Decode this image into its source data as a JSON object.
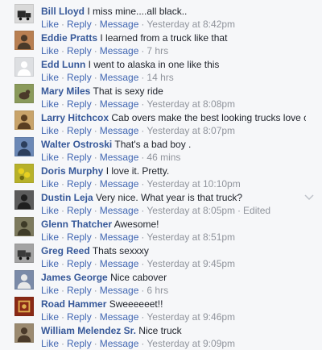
{
  "actions": {
    "like": "Like",
    "reply": "Reply",
    "message": "Message",
    "separator": "·"
  },
  "comments": [
    {
      "author": "Bill Lloyd",
      "text": "I miss mine....all black..",
      "time": "Yesterday at 8:42pm",
      "edited": "",
      "avatar": {
        "bg": "#d9d9d9",
        "fg": "#2a2a2a",
        "icon": "truck-photo-icon"
      }
    },
    {
      "author": "Eddie Pratts",
      "text": "I learned from a truck like that",
      "time": "7 hrs",
      "edited": "",
      "avatar": {
        "bg": "#b87f52",
        "fg": "#4a3a2a",
        "icon": "person-photo-icon"
      }
    },
    {
      "author": "Edd Lunn",
      "text": "I went to alaska in one like this",
      "time": "14 hrs",
      "edited": "",
      "avatar": {
        "bg": "#dddfe2",
        "fg": "#ffffff",
        "icon": "default-profile-icon"
      }
    },
    {
      "author": "Mary Miles",
      "text": "That is sexy ride",
      "time": "Yesterday at 8:08pm",
      "edited": "",
      "avatar": {
        "bg": "#8a9a5b",
        "fg": "#4b3a2a",
        "icon": "animal-photo-icon"
      }
    },
    {
      "author": "Larry Hitchcox",
      "text": "Cab overs make the best looking trucks love cab overs",
      "time": "Yesterday at 8:07pm",
      "edited": "",
      "avatar": {
        "bg": "#c8a36a",
        "fg": "#5a3f22",
        "icon": "person-photo-icon"
      }
    },
    {
      "author": "Walter Ostroski",
      "text": "That's a bad boy .",
      "time": "46 mins",
      "edited": "",
      "avatar": {
        "bg": "#6b88b6",
        "fg": "#2c3e5c",
        "icon": "person-photo-icon"
      }
    },
    {
      "author": "Doris Murphy",
      "text": "I love it. Pretty.",
      "time": "Yesterday at 10:10pm",
      "edited": "",
      "avatar": {
        "bg": "#b7b12a",
        "fg": "#6f6a10",
        "icon": "flower-photo-icon"
      }
    },
    {
      "author": "Dustin Leja",
      "text": "Very nice. What year is that truck?",
      "time": "Yesterday at 8:05pm",
      "edited": "Edited",
      "avatar": {
        "bg": "#5b5b5b",
        "fg": "#1f1f1f",
        "icon": "person-photo-icon"
      }
    },
    {
      "author": "Glenn Thatcher",
      "text": "Awesome!",
      "time": "Yesterday at 8:51pm",
      "edited": "",
      "avatar": {
        "bg": "#7d7a5e",
        "fg": "#3e3b28",
        "icon": "person-photo-icon"
      }
    },
    {
      "author": "Greg Reed",
      "text": "Thats sexxxy",
      "time": "Yesterday at 9:45pm",
      "edited": "",
      "avatar": {
        "bg": "#a3a3a3",
        "fg": "#3a3a3a",
        "icon": "truck-photo-icon"
      }
    },
    {
      "author": "James George",
      "text": "Nice cabover",
      "time": "6 hrs",
      "edited": "",
      "avatar": {
        "bg": "#7a8aa8",
        "fg": "#e8e8e8",
        "icon": "person-photo-icon"
      }
    },
    {
      "author": "Road Hammer",
      "text": "Sweeeeeet!!",
      "time": "Yesterday at 9:46pm",
      "edited": "",
      "avatar": {
        "bg": "#8a2a16",
        "fg": "#e0b050",
        "icon": "logo-photo-icon"
      }
    },
    {
      "author": "William Melendez Sr.",
      "text": "Nice truck",
      "time": "Yesterday at 9:09pm",
      "edited": "",
      "avatar": {
        "bg": "#9b8a70",
        "fg": "#4a3a2a",
        "icon": "person-photo-icon"
      }
    }
  ],
  "colors": {
    "link": "#365899",
    "action": "#4267b2",
    "meta": "#90949c",
    "text": "#1d2129",
    "background": "#f6f7f9"
  }
}
